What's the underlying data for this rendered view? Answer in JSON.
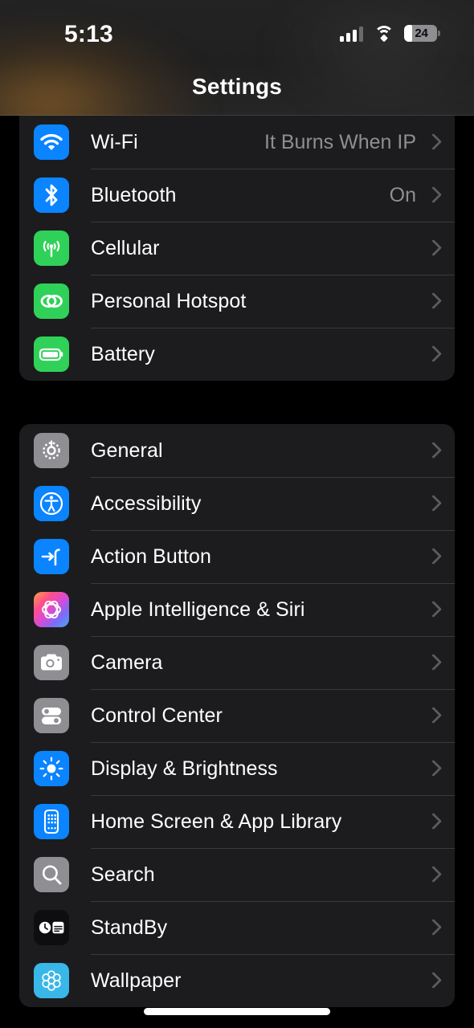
{
  "status_bar": {
    "time": "5:13",
    "battery_percent": "24",
    "signal_icon": "cellular-signal-icon",
    "wifi_icon": "wifi-icon",
    "battery_icon": "battery-icon"
  },
  "nav": {
    "title": "Settings"
  },
  "groups": [
    {
      "id": "connectivity",
      "clipped_top": true,
      "rows": [
        {
          "label": "Wi-Fi",
          "value": "It Burns When IP",
          "icon": "wifi-icon",
          "icon_color": "#0a84ff"
        },
        {
          "label": "Bluetooth",
          "value": "On",
          "icon": "bluetooth-icon",
          "icon_color": "#0a84ff"
        },
        {
          "label": "Cellular",
          "value": "",
          "icon": "cellular-icon",
          "icon_color": "#30d158"
        },
        {
          "label": "Personal Hotspot",
          "value": "",
          "icon": "hotspot-link-icon",
          "icon_color": "#30d158"
        },
        {
          "label": "Battery",
          "value": "",
          "icon": "battery-icon",
          "icon_color": "#30d158"
        }
      ]
    },
    {
      "id": "system",
      "clipped_top": false,
      "rows": [
        {
          "label": "General",
          "value": "",
          "icon": "gear-icon",
          "icon_color": "#8e8e93"
        },
        {
          "label": "Accessibility",
          "value": "",
          "icon": "accessibility-icon",
          "icon_color": "#0a84ff"
        },
        {
          "label": "Action Button",
          "value": "",
          "icon": "action-button-icon",
          "icon_color": "#0a84ff"
        },
        {
          "label": "Apple Intelligence & Siri",
          "value": "",
          "icon": "apple-intelligence-icon",
          "icon_color": "gradient"
        },
        {
          "label": "Camera",
          "value": "",
          "icon": "camera-icon",
          "icon_color": "#8e8e93"
        },
        {
          "label": "Control Center",
          "value": "",
          "icon": "control-center-icon",
          "icon_color": "#8e8e93"
        },
        {
          "label": "Display & Brightness",
          "value": "",
          "icon": "brightness-sun-icon",
          "icon_color": "#0a84ff"
        },
        {
          "label": "Home Screen & App Library",
          "value": "",
          "icon": "home-screen-icon",
          "icon_color": "#0a84ff"
        },
        {
          "label": "Search",
          "value": "",
          "icon": "search-icon",
          "icon_color": "#8e8e93"
        },
        {
          "label": "StandBy",
          "value": "",
          "icon": "standby-icon",
          "icon_color": "#0e0e10"
        },
        {
          "label": "Wallpaper",
          "value": "",
          "icon": "wallpaper-flower-icon",
          "icon_color": "#39b7e8"
        }
      ]
    }
  ],
  "colors": {
    "background": "#000000",
    "card": "#1c1c1e",
    "separator": "#3a3a3c",
    "label": "#ffffff",
    "value": "#8e8e93",
    "chevron": "#5b5b60",
    "accent_blue": "#0a84ff",
    "accent_green": "#30d158"
  }
}
